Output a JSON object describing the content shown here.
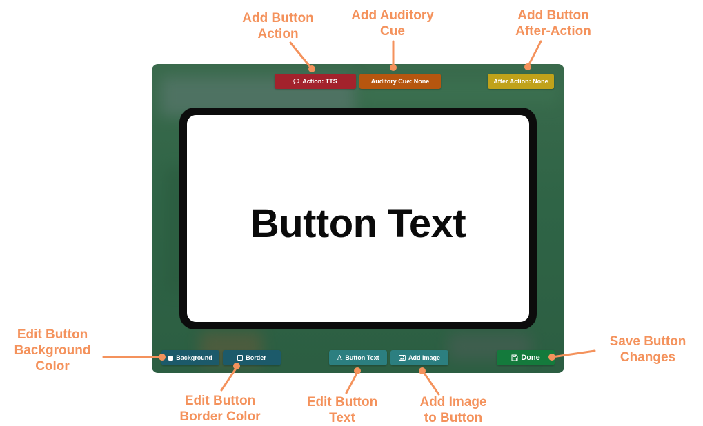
{
  "editor": {
    "top_bar": {
      "action_label": "Action: TTS",
      "cue_label": "Auditory Cue: None",
      "after_label": "After Action: None"
    },
    "preview": {
      "button_text": "Button Text"
    },
    "bottom_bar": {
      "background_label": "Background",
      "border_label": "Border",
      "text_label": "Button Text",
      "image_label": "Add Image",
      "done_label": "Done"
    }
  },
  "annotations": {
    "action": [
      "Add Button",
      "Action"
    ],
    "cue": [
      "Add Auditory",
      "Cue"
    ],
    "after": [
      "Add Button",
      "After-Action"
    ],
    "background": [
      "Edit Button",
      "Background",
      "Color"
    ],
    "border": [
      "Edit Button",
      "Border Color"
    ],
    "text": [
      "Edit Button",
      "Text"
    ],
    "image": [
      "Add Image",
      "to Button"
    ],
    "save": [
      "Save Button",
      "Changes"
    ]
  },
  "colors": {
    "annotation": "#f4925c",
    "panel": "#2f6446",
    "action_chip": "#a3222c",
    "cue_chip": "#b6560f",
    "after_chip": "#c0a21a",
    "style_chip": "#1c5a6a",
    "content_chip": "#2c7f80",
    "done_chip": "#147a3c"
  },
  "icons": {
    "action": "speech-bubble-icon",
    "background": "filled-square-icon",
    "border": "outline-square-icon",
    "text": "letter-a-icon",
    "image": "image-icon",
    "done": "save-disk-icon"
  }
}
